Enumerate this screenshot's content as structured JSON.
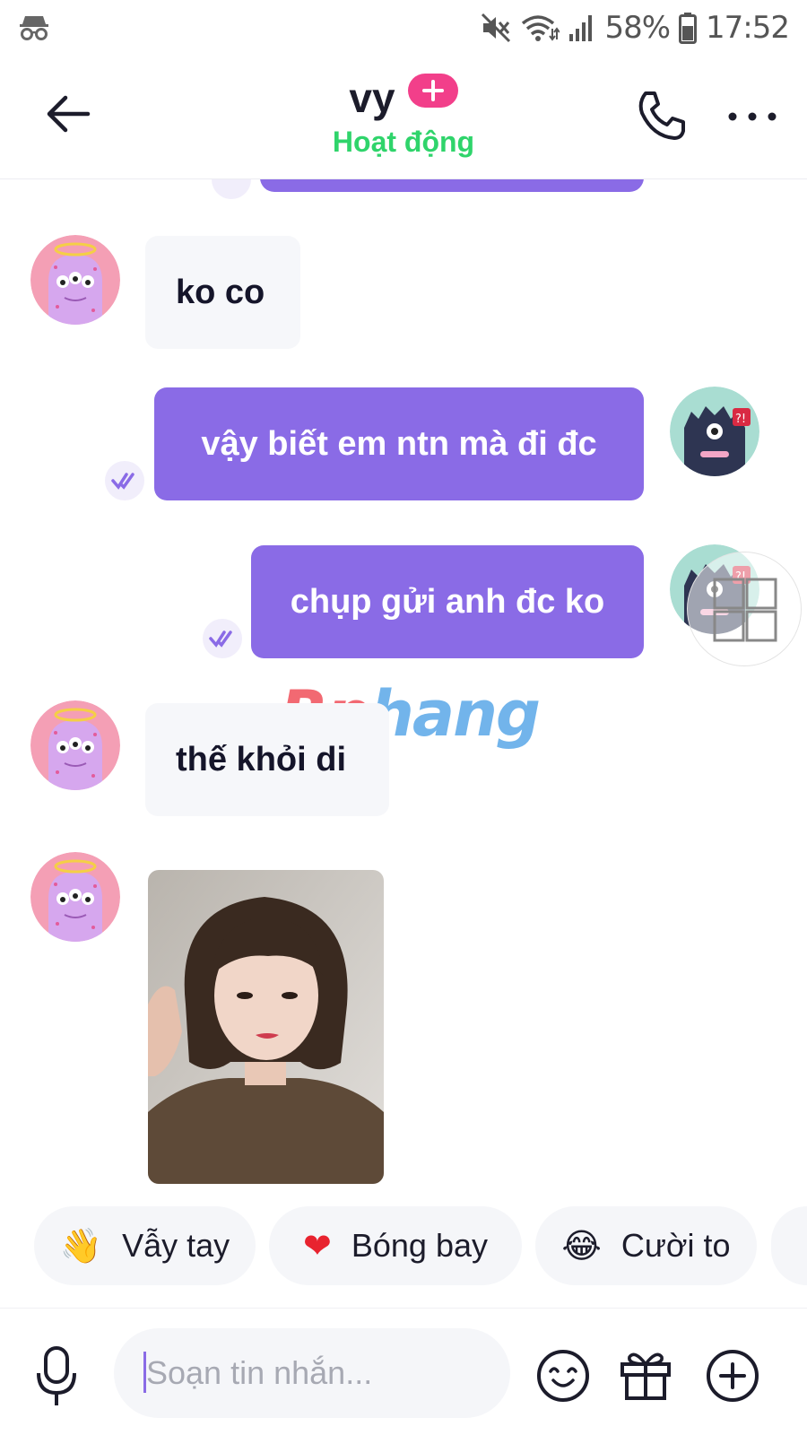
{
  "status_bar": {
    "battery": "58%",
    "time": "17:52"
  },
  "header": {
    "contact_name": "vy",
    "presence": "Hoạt động"
  },
  "messages": [
    {
      "direction": "incoming",
      "text": "ko co"
    },
    {
      "direction": "outgoing",
      "text": "vậy biết em ntn mà đi đc"
    },
    {
      "direction": "outgoing",
      "text": "chụp gửi anh đc ko"
    },
    {
      "direction": "incoming",
      "text": "thế khỏi di"
    },
    {
      "direction": "incoming",
      "type": "photo"
    }
  ],
  "watermark": {
    "part1": "Rp",
    "part2": "hang"
  },
  "quick_reactions": [
    {
      "emoji": "👋",
      "label": "Vẫy tay"
    },
    {
      "emoji": "❤",
      "label": "Bóng bay"
    },
    {
      "emoji": "😂",
      "label": "Cười to"
    }
  ],
  "composer": {
    "placeholder": "Soạn tin nhắn..."
  },
  "colors": {
    "accent": "#8a6be6",
    "presence": "#2fd46b",
    "plus_badge": "#f23f8a",
    "incoming_bubble": "#f6f7fa"
  }
}
